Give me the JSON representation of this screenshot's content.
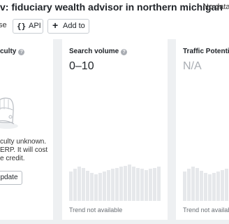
{
  "header": {
    "title": "v: fiduciary wealth advisor in northern michigan",
    "no_data": "No data",
    "cut_button_label": "se",
    "api_icon": "{}",
    "api_label": "API",
    "add_icon": "+",
    "add_label": "Add to"
  },
  "cards": {
    "difficulty": {
      "title": "culty",
      "help_icon": "?",
      "illustration": "hard-hat-icon",
      "message_lines": [
        "culty unknown.",
        "ERP. It will cost",
        "e credit."
      ],
      "update_label": "pdate"
    },
    "volume": {
      "title": "Search volume",
      "help_icon": "?",
      "value": "0–10",
      "trend_label": "Trend not available",
      "bar_levels": [
        0.55,
        0.6,
        0.64,
        0.62,
        0.56,
        0.52,
        0.5,
        0.52,
        0.55,
        0.58,
        0.6,
        0.62,
        0.64,
        0.66,
        0.68,
        0.64,
        0.62,
        0.6,
        0.58,
        0.6,
        0.62,
        0.64
      ]
    },
    "traffic": {
      "title": "Traffic Potential",
      "value": "N/A",
      "trend_label": "Trend not available",
      "bar_levels": [
        0.55,
        0.6,
        0.64,
        0.62,
        0.56,
        0.52,
        0.5,
        0.52,
        0.55,
        0.58,
        0.6,
        0.62,
        0.64
      ]
    }
  },
  "colors": {
    "background": "#eef0f2",
    "card": "#ffffff",
    "bar": "#e6e8eb",
    "muted_value": "#a9adb3"
  }
}
